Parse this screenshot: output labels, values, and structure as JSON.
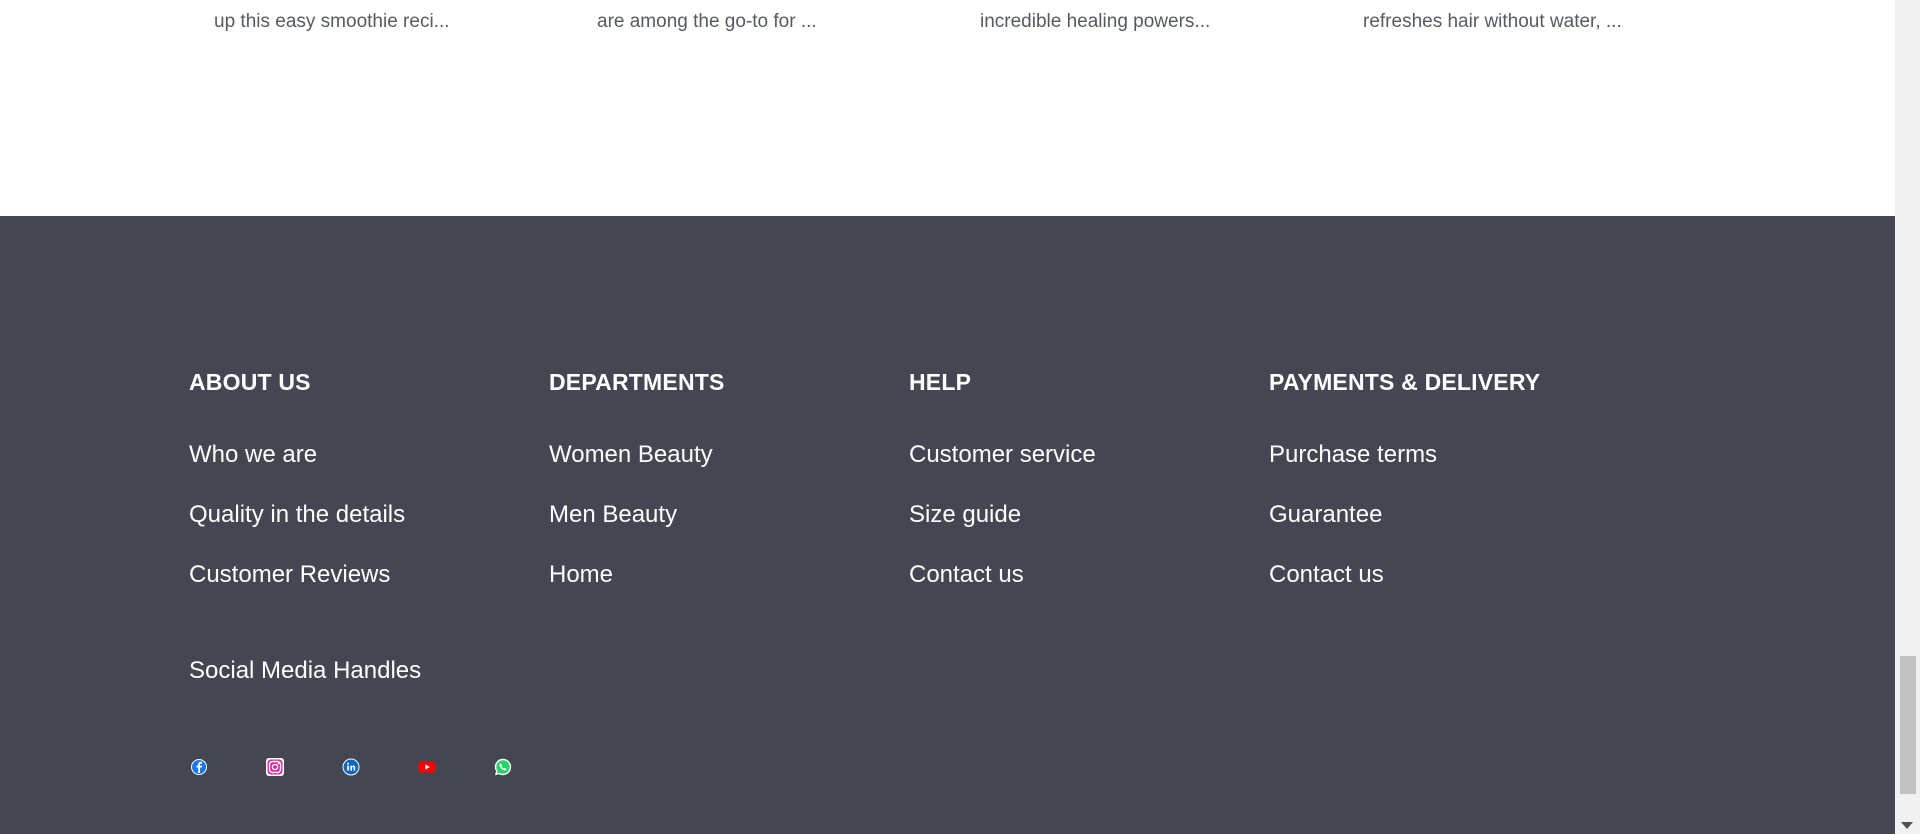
{
  "blog_teasers": [
    {
      "excerpt": "up this easy smoothie reci..."
    },
    {
      "excerpt": "are among the go-to for ..."
    },
    {
      "excerpt": "incredible healing powers..."
    },
    {
      "excerpt": "refreshes hair without water, ..."
    }
  ],
  "footer": {
    "columns": [
      {
        "heading": "ABOUT US",
        "links": [
          "Who we are",
          "Quality in the details",
          "Customer Reviews"
        ]
      },
      {
        "heading": "DEPARTMENTS",
        "links": [
          "Women Beauty",
          "Men Beauty",
          "Home"
        ]
      },
      {
        "heading": "HELP",
        "links": [
          "Customer service",
          "Size guide",
          "Contact us"
        ]
      },
      {
        "heading": "PAYMENTS & DELIVERY",
        "links": [
          "Purchase terms",
          "Guarantee",
          "Contact us"
        ]
      }
    ],
    "social_heading": "Social Media Handles",
    "social_icons": [
      "facebook-icon",
      "instagram-icon",
      "linkedin-icon",
      "youtube-icon",
      "whatsapp-icon"
    ]
  },
  "colors": {
    "footer_bg": "#444751",
    "footer_text": "#ffffff",
    "excerpt_text": "#555a63"
  }
}
